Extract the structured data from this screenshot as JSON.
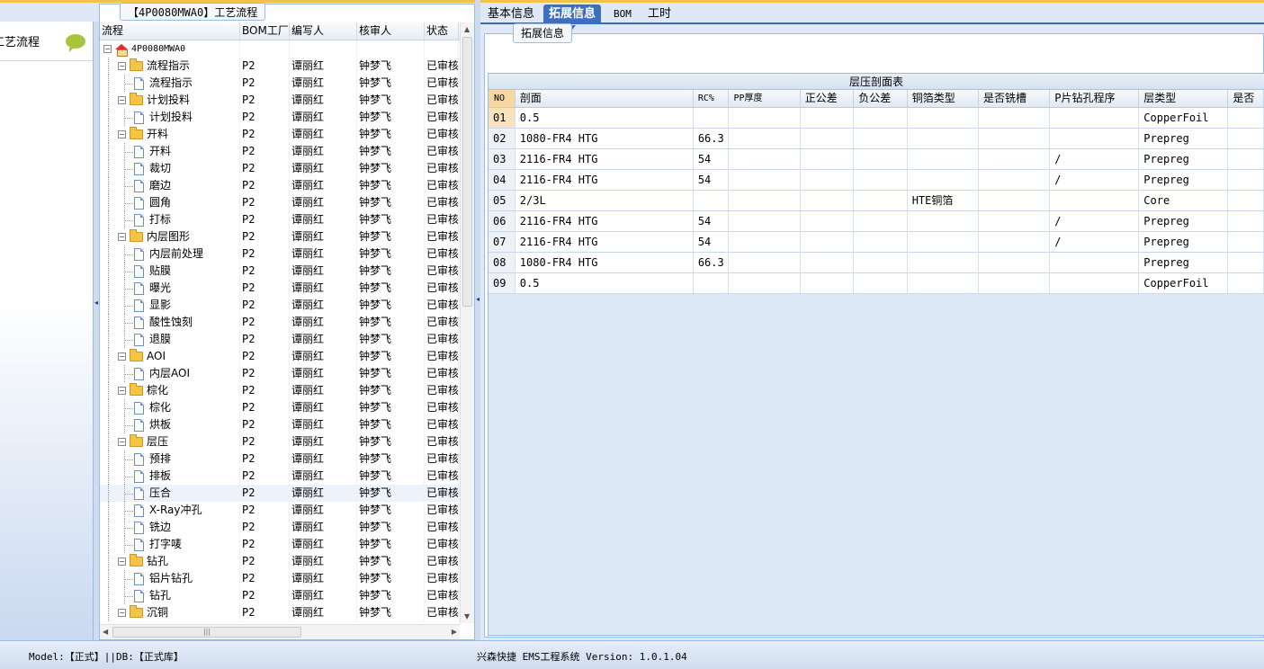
{
  "left_nav": {
    "item_label": "工艺流程"
  },
  "tree": {
    "title": "【4P0080MWA0】工艺流程",
    "columns": [
      "流程",
      "BOM工厂",
      "编写人",
      "核审人",
      "状态"
    ],
    "rows": [
      {
        "label": "4P0080MWA0",
        "level": 0,
        "type": "root",
        "bom": "",
        "writer": "",
        "reviewer": "",
        "status": ""
      },
      {
        "label": "流程指示",
        "level": 1,
        "type": "folder",
        "bom": "P2",
        "writer": "谭丽红",
        "reviewer": "钟梦飞",
        "status": "已审核"
      },
      {
        "label": "流程指示",
        "level": 2,
        "type": "doc",
        "bom": "P2",
        "writer": "谭丽红",
        "reviewer": "钟梦飞",
        "status": "已审核"
      },
      {
        "label": "计划投料",
        "level": 1,
        "type": "folder",
        "bom": "P2",
        "writer": "谭丽红",
        "reviewer": "钟梦飞",
        "status": "已审核"
      },
      {
        "label": "计划投料",
        "level": 2,
        "type": "doc",
        "bom": "P2",
        "writer": "谭丽红",
        "reviewer": "钟梦飞",
        "status": "已审核"
      },
      {
        "label": "开料",
        "level": 1,
        "type": "folder",
        "bom": "P2",
        "writer": "谭丽红",
        "reviewer": "钟梦飞",
        "status": "已审核"
      },
      {
        "label": "开料",
        "level": 2,
        "type": "doc",
        "bom": "P2",
        "writer": "谭丽红",
        "reviewer": "钟梦飞",
        "status": "已审核"
      },
      {
        "label": "裁切",
        "level": 2,
        "type": "doc",
        "bom": "P2",
        "writer": "谭丽红",
        "reviewer": "钟梦飞",
        "status": "已审核"
      },
      {
        "label": "磨边",
        "level": 2,
        "type": "doc",
        "bom": "P2",
        "writer": "谭丽红",
        "reviewer": "钟梦飞",
        "status": "已审核"
      },
      {
        "label": "圆角",
        "level": 2,
        "type": "doc",
        "bom": "P2",
        "writer": "谭丽红",
        "reviewer": "钟梦飞",
        "status": "已审核"
      },
      {
        "label": "打标",
        "level": 2,
        "type": "doc",
        "bom": "P2",
        "writer": "谭丽红",
        "reviewer": "钟梦飞",
        "status": "已审核"
      },
      {
        "label": "内层图形",
        "level": 1,
        "type": "folder",
        "bom": "P2",
        "writer": "谭丽红",
        "reviewer": "钟梦飞",
        "status": "已审核"
      },
      {
        "label": "内层前处理",
        "level": 2,
        "type": "doc",
        "bom": "P2",
        "writer": "谭丽红",
        "reviewer": "钟梦飞",
        "status": "已审核"
      },
      {
        "label": "贴膜",
        "level": 2,
        "type": "doc",
        "bom": "P2",
        "writer": "谭丽红",
        "reviewer": "钟梦飞",
        "status": "已审核"
      },
      {
        "label": "曝光",
        "level": 2,
        "type": "doc",
        "bom": "P2",
        "writer": "谭丽红",
        "reviewer": "钟梦飞",
        "status": "已审核"
      },
      {
        "label": "显影",
        "level": 2,
        "type": "doc",
        "bom": "P2",
        "writer": "谭丽红",
        "reviewer": "钟梦飞",
        "status": "已审核"
      },
      {
        "label": "酸性蚀刻",
        "level": 2,
        "type": "doc",
        "bom": "P2",
        "writer": "谭丽红",
        "reviewer": "钟梦飞",
        "status": "已审核"
      },
      {
        "label": "退膜",
        "level": 2,
        "type": "doc",
        "bom": "P2",
        "writer": "谭丽红",
        "reviewer": "钟梦飞",
        "status": "已审核"
      },
      {
        "label": "AOI",
        "level": 1,
        "type": "folder",
        "bom": "P2",
        "writer": "谭丽红",
        "reviewer": "钟梦飞",
        "status": "已审核"
      },
      {
        "label": "内层AOI",
        "level": 2,
        "type": "doc",
        "bom": "P2",
        "writer": "谭丽红",
        "reviewer": "钟梦飞",
        "status": "已审核"
      },
      {
        "label": "棕化",
        "level": 1,
        "type": "folder",
        "bom": "P2",
        "writer": "谭丽红",
        "reviewer": "钟梦飞",
        "status": "已审核"
      },
      {
        "label": "棕化",
        "level": 2,
        "type": "doc",
        "bom": "P2",
        "writer": "谭丽红",
        "reviewer": "钟梦飞",
        "status": "已审核"
      },
      {
        "label": "烘板",
        "level": 2,
        "type": "doc",
        "bom": "P2",
        "writer": "谭丽红",
        "reviewer": "钟梦飞",
        "status": "已审核"
      },
      {
        "label": "层压",
        "level": 1,
        "type": "folder",
        "bom": "P2",
        "writer": "谭丽红",
        "reviewer": "钟梦飞",
        "status": "已审核"
      },
      {
        "label": "预排",
        "level": 2,
        "type": "doc",
        "bom": "P2",
        "writer": "谭丽红",
        "reviewer": "钟梦飞",
        "status": "已审核"
      },
      {
        "label": "排板",
        "level": 2,
        "type": "doc",
        "bom": "P2",
        "writer": "谭丽红",
        "reviewer": "钟梦飞",
        "status": "已审核"
      },
      {
        "label": "压合",
        "level": 2,
        "type": "doc",
        "bom": "P2",
        "writer": "谭丽红",
        "reviewer": "钟梦飞",
        "status": "已审核",
        "selected": true
      },
      {
        "label": "X-Ray冲孔",
        "level": 2,
        "type": "doc",
        "bom": "P2",
        "writer": "谭丽红",
        "reviewer": "钟梦飞",
        "status": "已审核"
      },
      {
        "label": "铣边",
        "level": 2,
        "type": "doc",
        "bom": "P2",
        "writer": "谭丽红",
        "reviewer": "钟梦飞",
        "status": "已审核"
      },
      {
        "label": "打字唛",
        "level": 2,
        "type": "doc",
        "bom": "P2",
        "writer": "谭丽红",
        "reviewer": "钟梦飞",
        "status": "已审核"
      },
      {
        "label": "钻孔",
        "level": 1,
        "type": "folder",
        "bom": "P2",
        "writer": "谭丽红",
        "reviewer": "钟梦飞",
        "status": "已审核"
      },
      {
        "label": "铝片钻孔",
        "level": 2,
        "type": "doc",
        "bom": "P2",
        "writer": "谭丽红",
        "reviewer": "钟梦飞",
        "status": "已审核"
      },
      {
        "label": "钻孔",
        "level": 2,
        "type": "doc",
        "bom": "P2",
        "writer": "谭丽红",
        "reviewer": "钟梦飞",
        "status": "已审核"
      },
      {
        "label": "沉铜",
        "level": 1,
        "type": "folder",
        "bom": "P2",
        "writer": "谭丽红",
        "reviewer": "钟梦飞",
        "status": "已审核"
      }
    ]
  },
  "tabs": [
    {
      "label": "基本信息",
      "active": false
    },
    {
      "label": "拓展信息",
      "active": true
    },
    {
      "label": "BOM",
      "active": false
    },
    {
      "label": "工时",
      "active": false
    }
  ],
  "ext": {
    "title": "拓展信息",
    "table_caption": "层压剖面表",
    "columns": [
      "NO",
      "剖面",
      "RC%",
      "PP厚度",
      "正公差",
      "负公差",
      "铜箔类型",
      "是否铣槽",
      "P片钻孔程序",
      "层类型",
      "是否"
    ],
    "rows": [
      {
        "no": "01",
        "section": "0.5",
        "rc": "",
        "pp": "",
        "pos": "",
        "neg": "",
        "cu": "",
        "mill": "",
        "drill": "",
        "type": "CopperFoil"
      },
      {
        "no": "02",
        "section": "1080-FR4 HTG",
        "rc": "66.3",
        "pp": "",
        "pos": "",
        "neg": "",
        "cu": "",
        "mill": "",
        "drill": "",
        "type": "Prepreg"
      },
      {
        "no": "03",
        "section": "2116-FR4 HTG",
        "rc": "54",
        "pp": "",
        "pos": "",
        "neg": "",
        "cu": "",
        "mill": "",
        "drill": "/",
        "type": "Prepreg"
      },
      {
        "no": "04",
        "section": "2116-FR4 HTG",
        "rc": "54",
        "pp": "",
        "pos": "",
        "neg": "",
        "cu": "",
        "mill": "",
        "drill": "/",
        "type": "Prepreg"
      },
      {
        "no": "05",
        "section": "2/3L",
        "rc": "",
        "pp": "",
        "pos": "",
        "neg": "",
        "cu": "HTE铜箔",
        "mill": "",
        "drill": "",
        "type": "Core"
      },
      {
        "no": "06",
        "section": "2116-FR4 HTG",
        "rc": "54",
        "pp": "",
        "pos": "",
        "neg": "",
        "cu": "",
        "mill": "",
        "drill": "/",
        "type": "Prepreg"
      },
      {
        "no": "07",
        "section": "2116-FR4 HTG",
        "rc": "54",
        "pp": "",
        "pos": "",
        "neg": "",
        "cu": "",
        "mill": "",
        "drill": "/",
        "type": "Prepreg"
      },
      {
        "no": "08",
        "section": "1080-FR4 HTG",
        "rc": "66.3",
        "pp": "",
        "pos": "",
        "neg": "",
        "cu": "",
        "mill": "",
        "drill": "",
        "type": "Prepreg"
      },
      {
        "no": "09",
        "section": "0.5",
        "rc": "",
        "pp": "",
        "pos": "",
        "neg": "",
        "cu": "",
        "mill": "",
        "drill": "",
        "type": "CopperFoil"
      }
    ]
  },
  "status": {
    "left": "Model:【正式】||DB:【正式库】",
    "right": "兴森快捷 EMS工程系统 Version: 1.0.1.04"
  },
  "colors": {
    "accent": "#3c6fc0",
    "top_strip": "#f0c24a",
    "panel_border": "#99bbe8"
  }
}
